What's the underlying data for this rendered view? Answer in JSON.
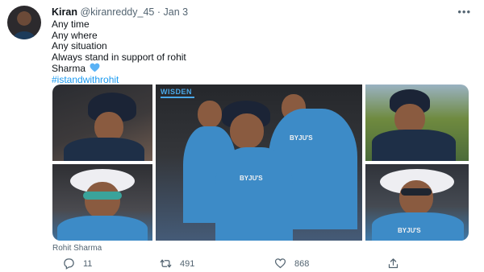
{
  "tweet": {
    "author_name": "Kiran",
    "handle": "@kiranreddy_45",
    "separator": "·",
    "date": "Jan 3",
    "more_label": "•••",
    "lines": [
      "Any time",
      "Any where",
      "Any situation",
      "Always stand in support of rohit",
      "Sharma"
    ],
    "hashtag": "#istandwithrohit",
    "heart_color": "#5ab2f5",
    "hashtag_color": "#1d9bf0"
  },
  "media": {
    "watermark": "WISDEN",
    "sponsor_text": "BYJU'S",
    "caption": "Rohit Sharma"
  },
  "actions": {
    "reply_count": "11",
    "retweet_count": "491",
    "like_count": "868"
  },
  "icons": [
    "reply-icon",
    "retweet-icon",
    "like-icon",
    "share-icon",
    "more-icon",
    "blue-heart-icon"
  ]
}
